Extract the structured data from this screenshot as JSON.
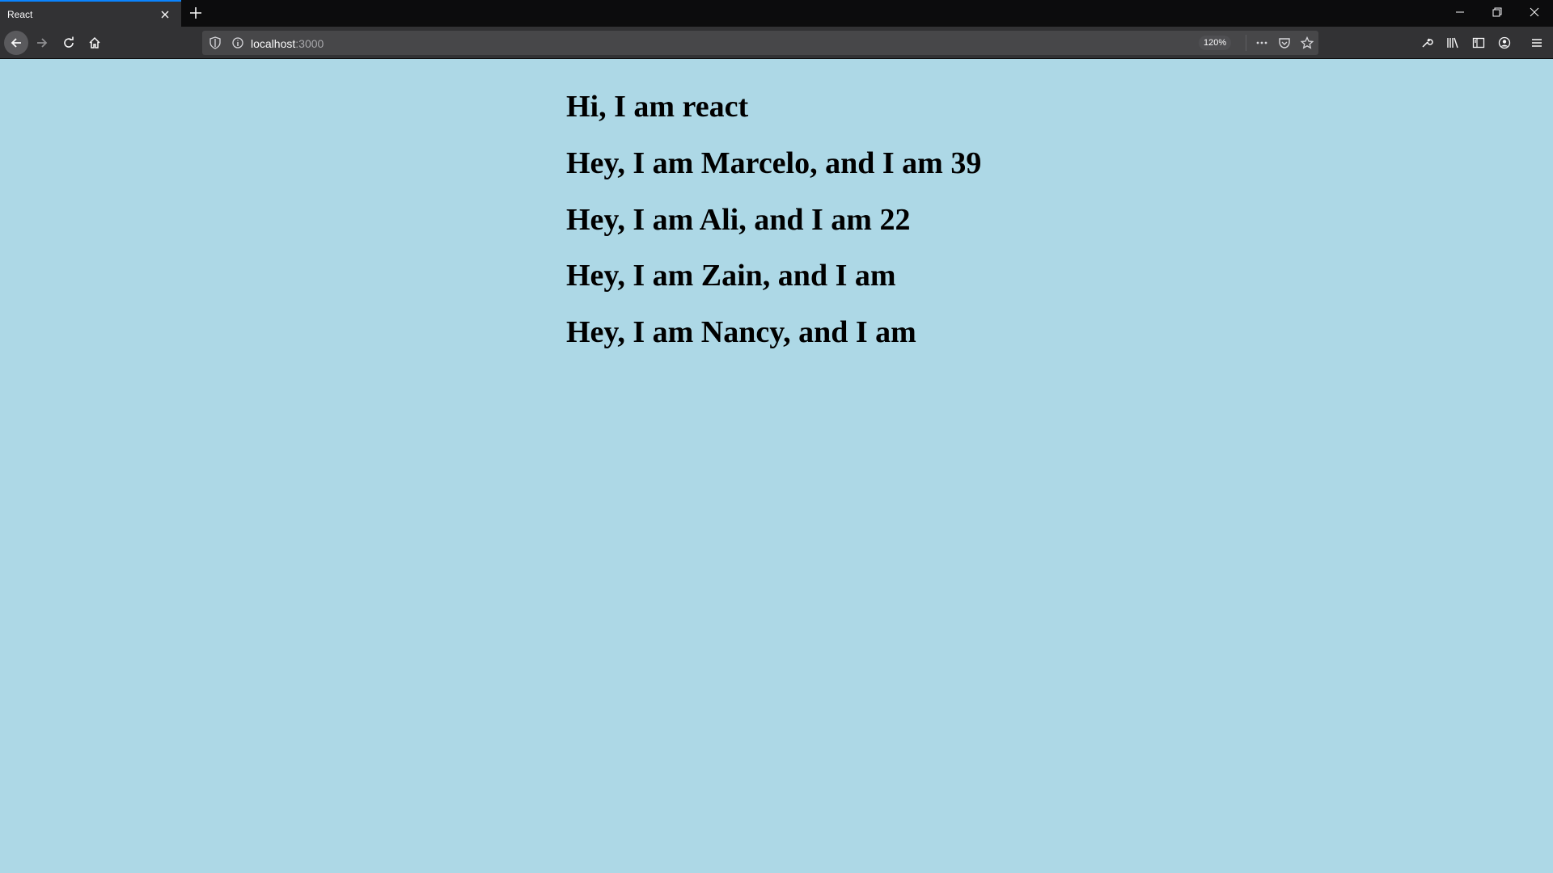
{
  "browser": {
    "tab_title": "React",
    "url_host": "localhost",
    "url_port": ":3000",
    "zoom": "120%"
  },
  "page": {
    "background": "#add8e6",
    "lines": [
      "Hi, I am react",
      "Hey, I am Marcelo, and I am 39",
      "Hey, I am Ali, and I am 22",
      "Hey, I am Zain, and I am",
      "Hey, I am Nancy, and I am"
    ]
  },
  "icons": {
    "tab_close": "close-icon",
    "new_tab": "plus-icon",
    "minimize": "minimize-icon",
    "restore": "restore-icon",
    "close_window": "close-icon",
    "back": "arrow-left-icon",
    "forward": "arrow-right-icon",
    "reload": "reload-icon",
    "home": "home-icon",
    "shield": "shield-icon",
    "info": "info-icon",
    "page_actions": "more-icon",
    "pocket": "pocket-icon",
    "bookmark": "star-icon",
    "devtools": "wrench-icon",
    "library": "library-icon",
    "sidebar": "sidebar-icon",
    "account": "account-icon",
    "menu": "hamburger-icon"
  }
}
